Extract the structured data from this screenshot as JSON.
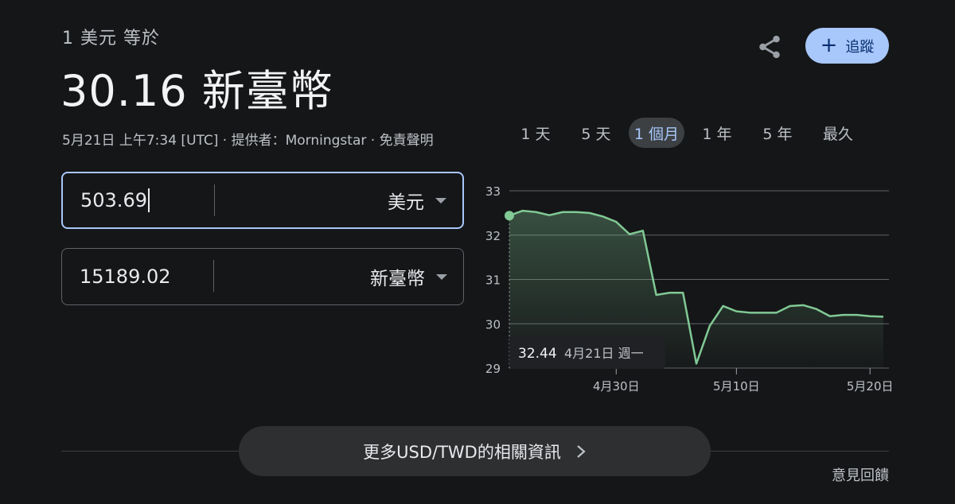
{
  "header": {
    "subtitle": "1 美元 等於",
    "main_value": "30.16 新臺幣",
    "meta": "5月21日 上午7:34 [UTC] · 提供者：Morningstar · 免責聲明",
    "track_label": "追蹤"
  },
  "converter": {
    "from_amount": "503.69",
    "from_currency": "美元",
    "to_amount": "15189.02",
    "to_currency": "新臺幣"
  },
  "range_tabs": [
    "1 天",
    "5 天",
    "1 個月",
    "1 年",
    "5 年",
    "最久"
  ],
  "active_tab": "1 個月",
  "tooltip": {
    "value": "32.44",
    "date": "4月21日 週一"
  },
  "colors": {
    "line": "#81c995",
    "accent": "#a8c7fa"
  },
  "chart_data": {
    "type": "area",
    "x": [
      "4月21日",
      "4月22日",
      "4月23日",
      "4月24日",
      "4月25日",
      "4月26日",
      "4月28日",
      "4月29日",
      "4月30日",
      "5月1日",
      "5月2日",
      "5月3日",
      "5月5日",
      "5月6日",
      "5月7日",
      "5月8日",
      "5月9日",
      "5月10日",
      "5月11日",
      "5月12日",
      "5月13日",
      "5月14日",
      "5月15日",
      "5月16日",
      "5月17日",
      "5月18日",
      "5月19日",
      "5月20日",
      "5月21日"
    ],
    "values": [
      32.44,
      32.55,
      32.52,
      32.45,
      32.52,
      32.52,
      32.5,
      32.42,
      32.3,
      32.02,
      32.1,
      30.65,
      30.7,
      30.7,
      29.1,
      29.95,
      30.4,
      30.28,
      30.25,
      30.25,
      30.25,
      30.4,
      30.42,
      30.33,
      30.17,
      30.2,
      30.2,
      30.17,
      30.16
    ],
    "ylim": [
      29,
      33
    ],
    "yticks": [
      29,
      30,
      31,
      32,
      33
    ],
    "xtick_labels": [
      "4月30日",
      "5月10日",
      "5月20日"
    ],
    "grid": true
  },
  "footer": {
    "more_label": "更多USD/TWD的相關資訊",
    "feedback_label": "意見回饋"
  }
}
